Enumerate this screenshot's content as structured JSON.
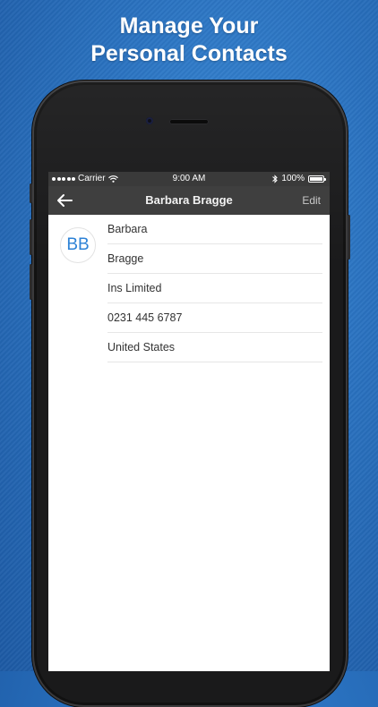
{
  "headline": {
    "line1": "Manage Your",
    "line2": "Personal Contacts"
  },
  "status_bar": {
    "carrier": "Carrier",
    "time": "9:00 AM",
    "battery": "100%"
  },
  "nav": {
    "title": "Barbara Bragge",
    "edit_label": "Edit"
  },
  "contact": {
    "initials": "BB",
    "fields": [
      {
        "value": "Barbara"
      },
      {
        "value": "Bragge"
      },
      {
        "value": "Ins Limited"
      },
      {
        "value": "0231 445 6787"
      },
      {
        "value": "United States"
      }
    ]
  },
  "colors": {
    "accent": "#2d82d6",
    "nav_bg": "#3f3f3f",
    "background": "#2a72c0"
  }
}
